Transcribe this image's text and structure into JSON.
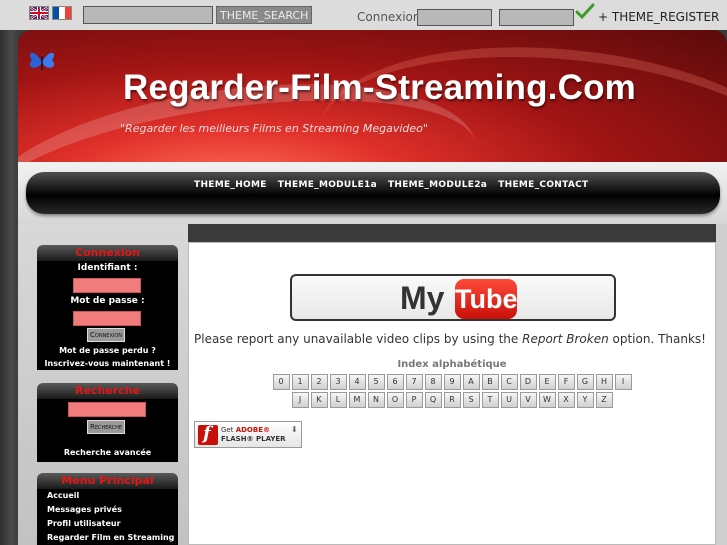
{
  "topbar": {
    "search_placeholder": "",
    "search_button": "THEME_SEARCH",
    "connexion_label": "Connexion",
    "register_link": "+ THEME_REGISTER"
  },
  "header": {
    "title": "Regarder-Film-Streaming.Com",
    "slogan": "\"Regarder les meilleurs Films en Streaming Megavideo\""
  },
  "nav": {
    "items": [
      "THEME_HOME",
      "THEME_MODULE1a",
      "THEME_MODULE2a",
      "THEME_CONTACT"
    ]
  },
  "sidebar": {
    "login": {
      "title": "Connexion",
      "id_label": "Identifiant :",
      "pass_label": "Mot de passe :",
      "button": "Connexion",
      "lost_password": "Mot de passe perdu ?",
      "register": "Inscrivez-vous maintenant !"
    },
    "search": {
      "title": "Recherche",
      "button": "Recherche",
      "advanced": "Recherche avancée"
    },
    "menu": {
      "title": "Menu Principal",
      "items": [
        "Accueil",
        "Messages privés",
        "Profil utilisateur",
        "Regarder Film en Streaming"
      ]
    }
  },
  "main": {
    "logo_my": "My",
    "logo_tube": "Tube",
    "report_before": "Please report any unavailable video clips by using the ",
    "report_italic": "Report Broken",
    "report_after": " option. Thanks!",
    "index_title": "Index alphabétique",
    "row1": [
      "0",
      "1",
      "2",
      "3",
      "4",
      "5",
      "6",
      "7",
      "8",
      "9",
      "A",
      "B",
      "C",
      "D",
      "E",
      "F",
      "G",
      "H",
      "I"
    ],
    "row2": [
      "J",
      "K",
      "L",
      "M",
      "N",
      "O",
      "P",
      "Q",
      "R",
      "S",
      "T",
      "U",
      "V",
      "W",
      "X",
      "Y",
      "Z"
    ],
    "flash_line1_pre": "Get ",
    "flash_line1_brand": "ADOBE®",
    "flash_line2": "FLASH® PLAYER"
  },
  "colors": {
    "accent_red": "#e01818",
    "banner_red": "#a01414",
    "input_pink": "#f07c7c"
  }
}
